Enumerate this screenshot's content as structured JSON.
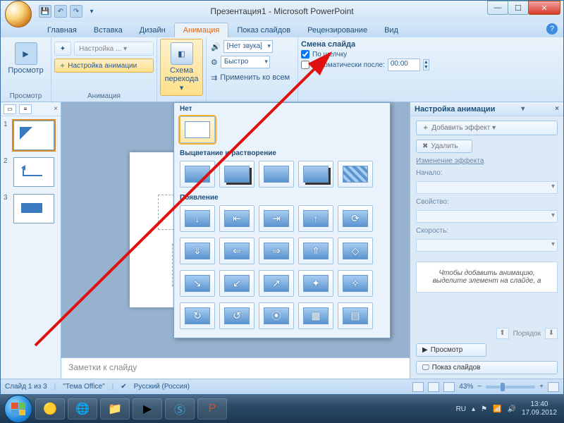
{
  "title": "Презентация1 - Microsoft PowerPoint",
  "qat": {
    "save": "💾",
    "undo": "↶",
    "redo": "↷",
    "more": "▾"
  },
  "winbtns": {
    "min": "—",
    "max": "☐",
    "close": "✕"
  },
  "tabs": [
    "Главная",
    "Вставка",
    "Дизайн",
    "Анимация",
    "Показ слайдов",
    "Рецензирование",
    "Вид"
  ],
  "tabs_active": 3,
  "ribbon": {
    "preview": {
      "big": "Просмотр",
      "group": "Просмотр"
    },
    "anim": {
      "btn1": "Настройка ... ▾",
      "btn2": "Настройка анимации",
      "group": "Анимация"
    },
    "trans": {
      "big": "Схема\nперехода ▾",
      "sound": "[Нет звука]",
      "speed": "Быстро",
      "apply": "Применить ко всем",
      "section": "Смена слайда",
      "chk_click": "По щелчку",
      "chk_auto": "Автоматически после:",
      "auto_time": "00:00"
    }
  },
  "gallery": {
    "cat_none": "Нет",
    "cat_fade": "Выцветание и растворение",
    "cat_appear": "Появление"
  },
  "slides": [
    {
      "num": "1"
    },
    {
      "num": "2"
    },
    {
      "num": "3"
    }
  ],
  "notes_placeholder": "Заметки к слайду",
  "taskpane": {
    "title": "Настройка анимации",
    "add": "Добавить эффект ▾",
    "del": "Удалить",
    "change": "Изменение эффекта",
    "l_start": "Начало:",
    "l_prop": "Свойство:",
    "l_speed": "Скорость:",
    "hint": "Чтобы добавить анимацию, выделите элемент на слайде, а",
    "order": "Порядок",
    "preview": "Просмотр",
    "show": "Показ слайдов"
  },
  "status": {
    "slide": "Слайд 1 из 3",
    "theme": "\"Тема Office\"",
    "lang": "Русский (Россия)",
    "zoom": "43%"
  },
  "tray": {
    "lang": "RU",
    "time": "13:40",
    "date": "17.09.2012"
  }
}
